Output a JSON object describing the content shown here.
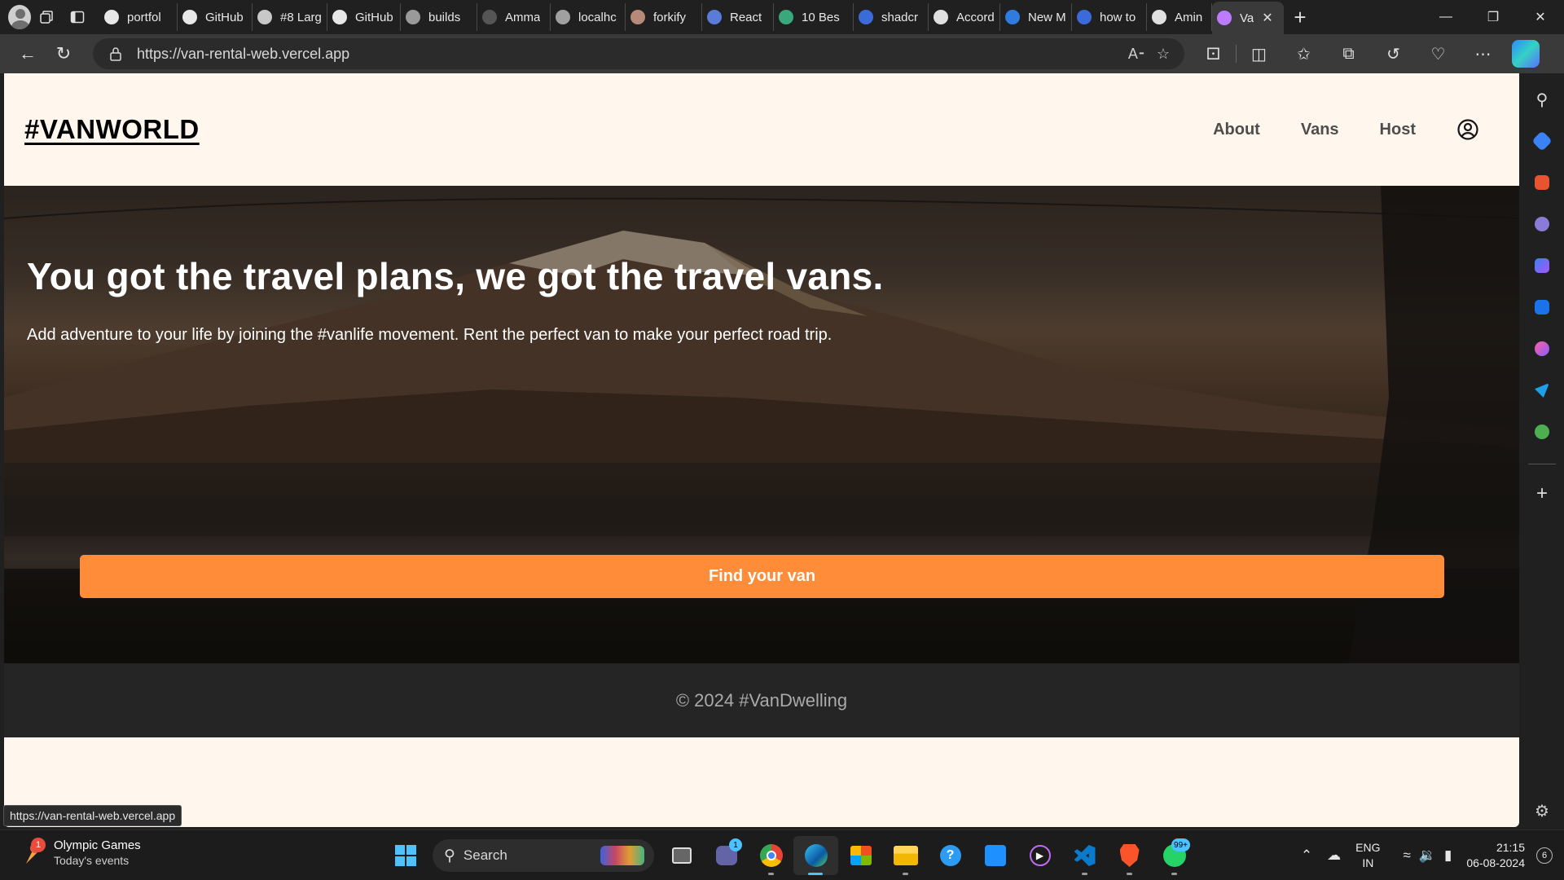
{
  "browser": {
    "tabs": [
      {
        "title": "portfol",
        "icon": "github-icon",
        "color": "#e8e8e8"
      },
      {
        "title": "GitHub",
        "icon": "github-icon",
        "color": "#e8e8e8"
      },
      {
        "title": "#8 Larg",
        "icon": "pe-icon",
        "color": "#c8c8c8"
      },
      {
        "title": "GitHub",
        "icon": "github-icon",
        "color": "#e8e8e8"
      },
      {
        "title": "builds",
        "icon": "builds-icon",
        "color": "#9a9a9a"
      },
      {
        "title": "Amma",
        "icon": "chat-icon",
        "color": "#555555"
      },
      {
        "title": "localhc",
        "icon": "localhost-icon",
        "color": "#a0a0a0"
      },
      {
        "title": "forkify",
        "icon": "forkify-icon",
        "color": "#b58a78"
      },
      {
        "title": "React",
        "icon": "document-icon",
        "color": "#5a7bd8"
      },
      {
        "title": "10 Bes",
        "icon": "leaf-icon",
        "color": "#3aa87a"
      },
      {
        "title": "shadcr",
        "icon": "search-icon",
        "color": "#3a6bd8"
      },
      {
        "title": "Accord",
        "icon": "slash-icon",
        "color": "#e0e0e0"
      },
      {
        "title": "New M",
        "icon": "azure-icon",
        "color": "#2f7be0"
      },
      {
        "title": "how to",
        "icon": "search-icon",
        "color": "#3a6bd8"
      },
      {
        "title": "Amin E",
        "icon": "page-icon",
        "color": "#e0e0e0"
      },
      {
        "title": "Va",
        "icon": "vite-icon",
        "color": "#bd7cff",
        "active": true
      }
    ],
    "url": "https://van-rental-web.vercel.app",
    "status_url": "https://van-rental-web.vercel.app"
  },
  "site": {
    "logo": "#VANWORLD",
    "nav": [
      "About",
      "Vans",
      "Host"
    ],
    "hero": {
      "title": "You got the travel plans, we got the travel vans.",
      "subtitle": "Add adventure to your life by joining the #vanlife movement. Rent the perfect van to make your perfect road trip.",
      "cta": "Find your van"
    },
    "footer": "© 2024 #VanDwelling",
    "colors": {
      "accent": "#ff8c38",
      "background": "#fff7ed",
      "footer": "#252525"
    }
  },
  "taskbar": {
    "weather_title": "Olympic Games",
    "weather_subtitle": "Today's events",
    "weather_badge": "1",
    "search_label": "Search",
    "teams_badge": "1",
    "whatsapp_badge": "99+",
    "lang_1": "ENG",
    "lang_2": "IN",
    "time": "21:15",
    "date": "06-08-2024",
    "notifications": "6"
  }
}
